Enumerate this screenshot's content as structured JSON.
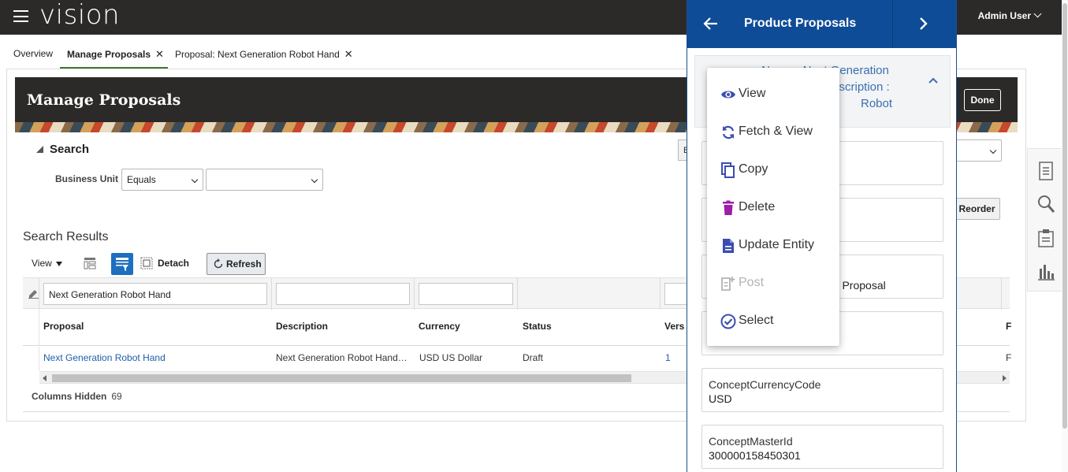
{
  "topbar": {
    "logo": "vision",
    "user": "Admin User"
  },
  "tabs": [
    {
      "label": "Overview"
    },
    {
      "label": "Manage Proposals",
      "active": true,
      "closable": true
    },
    {
      "label": "Proposal: Next Generation Robot Hand",
      "closable": true
    }
  ],
  "page": {
    "title": "Manage Proposals",
    "done_label": "Done",
    "done_mnemonic": "o"
  },
  "search": {
    "heading": "Search",
    "business_unit_label": "Business Unit",
    "operator_value": "Equals",
    "value": "",
    "reorder_label": "Reorder",
    "edge_button_label": "B"
  },
  "results": {
    "title": "Search Results",
    "view_label": "View",
    "detach_label": "Detach",
    "refresh_label": "Refresh",
    "filter_proposal": "Next Generation Robot Hand",
    "columns": [
      "Proposal",
      "Description",
      "Currency",
      "Status",
      "Vers",
      "F"
    ],
    "rows": [
      {
        "proposal": "Next Generation Robot Hand",
        "description": "Next Generation Robot Hand…",
        "currency": "USD US Dollar",
        "status": "Draft",
        "version": "1",
        "f": "F"
      }
    ],
    "columns_hidden_label": "Columns Hidden",
    "columns_hidden_count": "69"
  },
  "panel": {
    "title": "Product Proposals",
    "card_lines": [
      "Name : Next Generation",
      "Description :",
      "Robot"
    ],
    "field_fragments": [
      "nd",
      "nd Proposal"
    ],
    "fields": [
      {
        "label": "ConceptCurrencyCode",
        "value": "USD"
      },
      {
        "label": "ConceptMasterId",
        "value": "300000158450301"
      }
    ]
  },
  "menu": {
    "items": [
      {
        "label": "View",
        "icon": "eye-icon",
        "color": "#3b4db0"
      },
      {
        "label": "Fetch & View",
        "icon": "refresh-icon",
        "color": "#3b4db0"
      },
      {
        "label": "Copy",
        "icon": "copy-icon",
        "color": "#3b4db0"
      },
      {
        "label": "Delete",
        "icon": "trash-icon",
        "color": "#9b1fa8"
      },
      {
        "label": "Update Entity",
        "icon": "document-icon",
        "color": "#3b4db0"
      },
      {
        "label": "Post",
        "icon": "post-icon",
        "color": "#b3b3b3",
        "disabled": true
      },
      {
        "label": "Select",
        "icon": "check-circle-icon",
        "color": "#3b4db0"
      }
    ]
  },
  "colors": {
    "topbar": "#2c2a28",
    "panel_header": "#0f4c97",
    "link": "#1f5fa8",
    "accent_green": "#3f7a30"
  }
}
